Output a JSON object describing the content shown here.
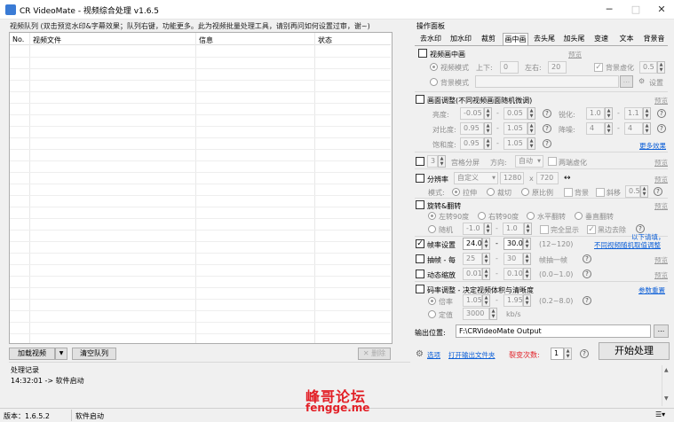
{
  "window": {
    "title": "CR VideoMate - 视频综合处理 v1.6.5",
    "minimize": "─",
    "maximize": "□",
    "close": "✕"
  },
  "queue": {
    "title": "视频队列 (双击预览水印&字幕效果；队列右键，功能更多。此为视频批量处理工具，请别再问如何设置过审，谢~)",
    "col_no": "No.",
    "col_file": "视频文件",
    "col_info": "信息",
    "col_status": "状态",
    "btn_add": "加载视频",
    "btn_clear": "清空队列",
    "btn_delete": "删除"
  },
  "panel": {
    "title": "操作面板",
    "tabs": [
      "去水印",
      "加水印",
      "裁剪",
      "画中画",
      "去头尾",
      "加头尾",
      "变速",
      "文本",
      "背景音"
    ],
    "active_tab": "画中画"
  },
  "pip": {
    "enable": "视频画中画",
    "preview": "预览",
    "video_mode": "视频模式",
    "updown": "上下:",
    "updown_val": "0",
    "leftright": "左右:",
    "leftright_val": "20",
    "bg_blur": "背景虚化",
    "bg_blur_val": "0.5",
    "bg_mode": "背景模式",
    "browse": "...",
    "settings": "设置"
  },
  "adjust": {
    "enable": "画面调整(不同视频画面随机微调)",
    "preview": "预览",
    "brightness": "亮度:",
    "b_min": "-0.05",
    "b_max": "0.05",
    "sharpen": "锐化:",
    "s_min": "1.0",
    "s_max": "1.1",
    "contrast": "对比度:",
    "c_min": "0.95",
    "c_max": "1.05",
    "denoise": "降噪:",
    "d_min": "4",
    "d_max": "4",
    "saturation": "饱和度:",
    "sa_min": "0.95",
    "sa_max": "1.05",
    "more": "更多效果"
  },
  "grid": {
    "value": "3",
    "label": "宫格分屏",
    "direction": "方向:",
    "direction_val": "自动",
    "blur": "两端虚化",
    "preview": "预览"
  },
  "resolution": {
    "enable": "分辨率",
    "preset": "自定义",
    "w": "1280",
    "x": "x",
    "h": "720",
    "swap": "↔",
    "preview": "预览",
    "mode": "模式:",
    "stretch": "拉伸",
    "crop": "裁切",
    "ratio": "原比例",
    "bg": "背景",
    "tilt": "斜移",
    "tilt_val": "0.5"
  },
  "rotate": {
    "enable": "旋转&翻转",
    "preview": "预览",
    "l90": "左转90度",
    "r90": "右转90度",
    "hflip": "水平翻转",
    "vflip": "垂直翻转",
    "random": "随机",
    "r_min": "-1.0",
    "r_max": "1.0",
    "full": "完全显示",
    "black": "黑边去除"
  },
  "frame": {
    "note1": "以下请填，",
    "note2": "不同视频随机取值调整",
    "rate_enable": "帧率设置",
    "rate_min": "24.0",
    "rate_max": "30.0",
    "rate_range": "(12~120)",
    "draw_enable": "抽帧 - 每",
    "draw_min": "25",
    "draw_max": "30",
    "draw_unit": "帧抽一帧",
    "draw_preview": "预览",
    "zoom_enable": "动态缩放",
    "zoom_min": "0.01",
    "zoom_max": "0.10",
    "zoom_range": "(0.0~1.0)",
    "zoom_preview": "预览"
  },
  "bitrate": {
    "enable": "码率调整 - 决定视频体积与清晰度",
    "params": "参数重置",
    "mult": "倍率",
    "m_min": "1.05",
    "m_max": "1.95",
    "m_range": "(0.2~8.0)",
    "fixed": "定值",
    "fixed_val": "3000",
    "unit": "kb/s"
  },
  "output": {
    "label": "输出位置:",
    "path": "F:\\CRVideoMate Output",
    "browse": "...",
    "start": "开始处理"
  },
  "options": {
    "opts": "选项",
    "open_dir": "打开输出文件夹",
    "split": "裂变次数:",
    "split_val": "1"
  },
  "log": {
    "title": "处理记录",
    "entry": "14:32:01 -> 软件启动"
  },
  "status": {
    "version": "版本：1.6.5.2",
    "msg": "软件启动"
  },
  "watermark": {
    "line1": "峰哥论坛",
    "line2": "fengge.me"
  }
}
